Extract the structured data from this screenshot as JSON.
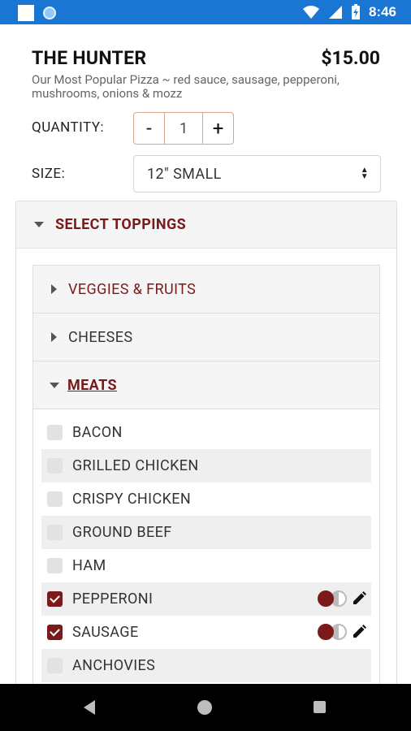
{
  "status_bar": {
    "time": "8:46",
    "icons": [
      "notification-square-icon",
      "sync-icon",
      "wifi-icon",
      "signal-icon",
      "battery-charging-icon"
    ]
  },
  "item": {
    "title": "THE HUNTER",
    "price": "$15.00",
    "description": "Our Most Popular Pizza ~ red sauce, sausage, pepperoni, mushrooms, onions & mozz"
  },
  "quantity": {
    "label": "QUANTITY:",
    "minus": "-",
    "value": "1",
    "plus": "+"
  },
  "size": {
    "label": "SIZE:",
    "selected": "12\" SMALL"
  },
  "toppings": {
    "header": "SELECT TOPPINGS",
    "sections": [
      {
        "label": "VEGGIES & FRUITS",
        "expanded": false
      },
      {
        "label": "CHEESES",
        "expanded": false
      },
      {
        "label": "MEATS",
        "expanded": true
      }
    ],
    "meats": [
      {
        "label": "BACON",
        "checked": false
      },
      {
        "label": "GRILLED CHICKEN",
        "checked": false
      },
      {
        "label": "CRISPY CHICKEN",
        "checked": false
      },
      {
        "label": "GROUND BEEF",
        "checked": false
      },
      {
        "label": "HAM",
        "checked": false
      },
      {
        "label": "PEPPERONI",
        "checked": true
      },
      {
        "label": "SAUSAGE",
        "checked": true
      },
      {
        "label": "ANCHOVIES",
        "checked": false
      }
    ]
  },
  "colors": {
    "accent": "#7b1a1a",
    "status_bar": "#1976d2",
    "nav_bar": "#000000"
  }
}
